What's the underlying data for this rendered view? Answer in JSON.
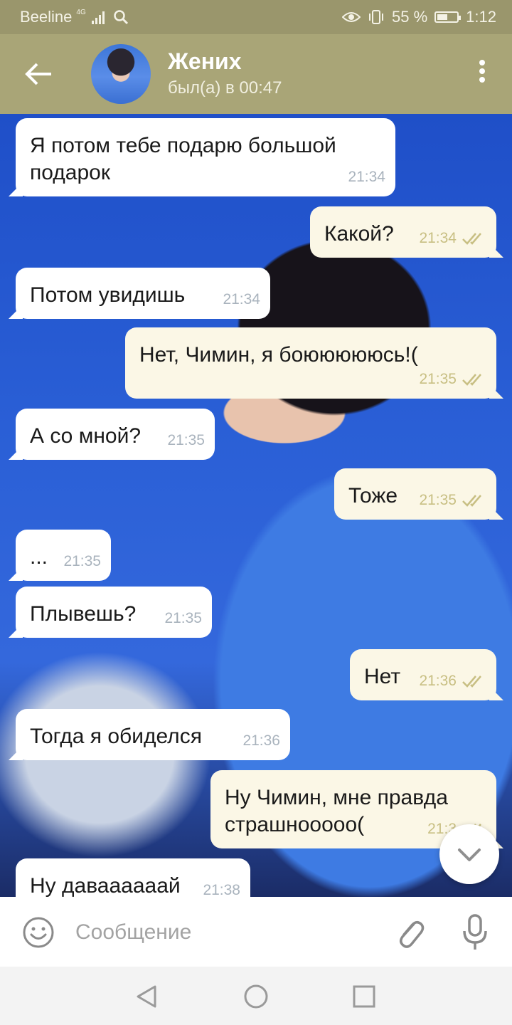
{
  "status_bar": {
    "carrier": "Beeline",
    "network": "4G",
    "battery": "55 %",
    "battery_level": 0.55,
    "time": "1:12",
    "icons": [
      "search-icon",
      "eye-icon",
      "vibrate-icon",
      "battery-icon"
    ]
  },
  "header": {
    "contact_name": "Жених",
    "last_seen": "был(а) в 00:47",
    "icons": [
      "back-arrow-icon",
      "more-vertical-icon"
    ]
  },
  "messages": [
    {
      "direction": "in",
      "text": "Я потом тебе подарю большой подарок",
      "time": "21:34"
    },
    {
      "direction": "out",
      "text": "Какой?",
      "time": "21:34",
      "read": true
    },
    {
      "direction": "in",
      "text": "Потом увидишь",
      "time": "21:34"
    },
    {
      "direction": "out",
      "text": "Нет, Чимин, я боюююююсь!(",
      "time": "21:35",
      "read": true
    },
    {
      "direction": "in",
      "text": "А со мной?",
      "time": "21:35"
    },
    {
      "direction": "out",
      "text": "Тоже",
      "time": "21:35",
      "read": true
    },
    {
      "direction": "in",
      "text": "...",
      "time": "21:35"
    },
    {
      "direction": "in",
      "text": "Плывешь?",
      "time": "21:35"
    },
    {
      "direction": "out",
      "text": "Нет",
      "time": "21:36",
      "read": true
    },
    {
      "direction": "in",
      "text": "Тогда я обиделся",
      "time": "21:36"
    },
    {
      "direction": "out",
      "text": "Ну Чимин, мне правда страшноoooo(",
      "time": "21:3",
      "read": true
    },
    {
      "direction": "in",
      "text": "Ну даваааааай",
      "time": "21:38"
    }
  ],
  "composer": {
    "placeholder": "Сообщение",
    "icons": [
      "emoji-icon",
      "attach-icon",
      "microphone-icon"
    ]
  },
  "scroll_down": {
    "icon": "chevron-down-icon"
  },
  "nav": {
    "icons": [
      "back-triangle-icon",
      "home-circle-icon",
      "recents-square-icon"
    ]
  },
  "colors": {
    "header": "#a9a577",
    "status_bar": "#9a966c",
    "incoming_bubble": "#ffffff",
    "outgoing_bubble": "#fbf7e6",
    "read_ticks": "#c8bf83"
  }
}
